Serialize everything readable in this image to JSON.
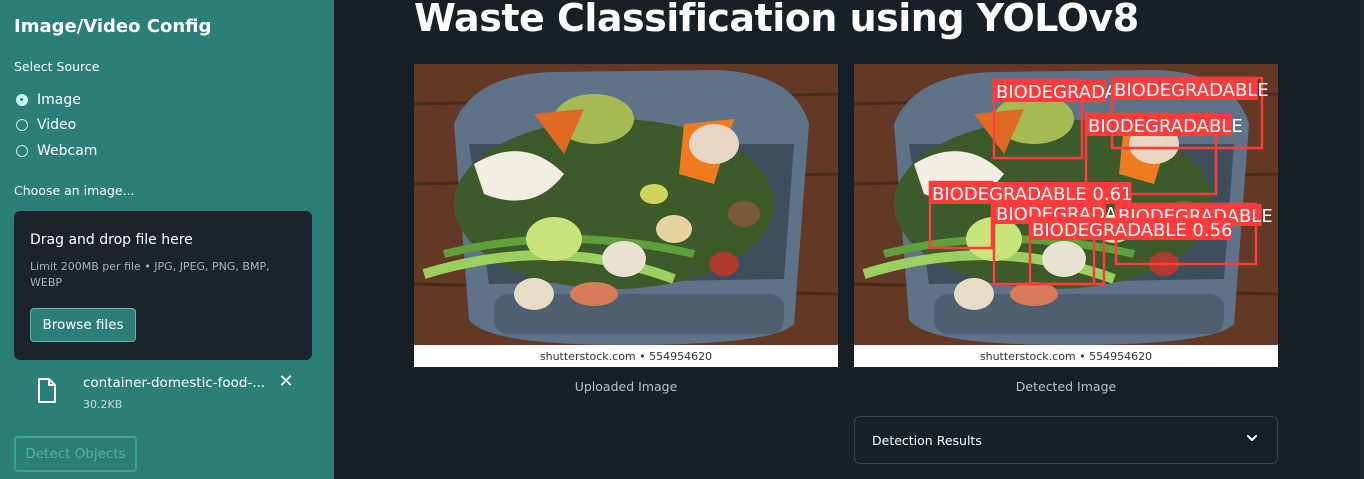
{
  "sidebar": {
    "title": "Image/Video Config",
    "source_label": "Select Source",
    "sources": [
      {
        "label": "Image",
        "checked": true
      },
      {
        "label": "Video",
        "checked": false
      },
      {
        "label": "Webcam",
        "checked": false
      }
    ],
    "choose_label": "Choose an image...",
    "uploader": {
      "title": "Drag and drop file here",
      "limit": "Limit 200MB per file • JPG, JPEG, PNG, BMP, WEBP",
      "browse_label": "Browse files"
    },
    "file": {
      "name": "container-domestic-food-...",
      "size": "30.2KB",
      "icon": "file-icon",
      "remove_icon": "close-icon",
      "remove_glyph": "✕"
    },
    "detect_label": "Detect Objects"
  },
  "main": {
    "title": "Waste Classification using YOLOv8",
    "uploaded": {
      "watermark": "shutterstock.com • 554954620",
      "caption": "Uploaded Image"
    },
    "detected": {
      "watermark": "shutterstock.com • 554954620",
      "caption": "Detected Image",
      "detections": [
        {
          "label": "BIODEGRADA"
        },
        {
          "label": "BIODEGRADABLE"
        },
        {
          "label": "BIODEGRADABLE"
        },
        {
          "label": "BIODEGRADABLE 0.61"
        },
        {
          "label": "BIODEGRADA"
        },
        {
          "label": "BIODEGRADABLE"
        },
        {
          "label": "BIODEGRADABLE 0.56"
        }
      ]
    },
    "expander": {
      "label": "Detection Results",
      "icon": "chevron-down-icon"
    }
  },
  "colors": {
    "sidebar_bg": "#2b7f78",
    "main_bg": "#172026",
    "detection_red": "#ff3b3b"
  }
}
